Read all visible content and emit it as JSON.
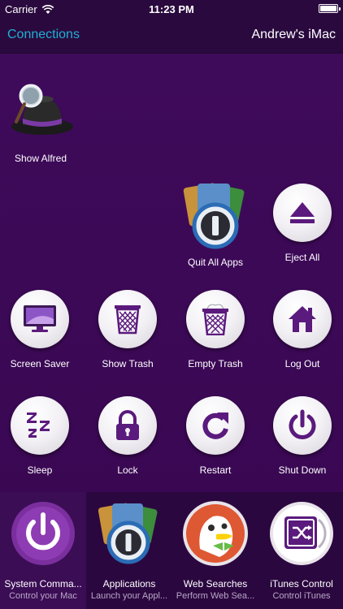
{
  "status_bar": {
    "carrier": "Carrier",
    "time": "11:23 PM"
  },
  "nav": {
    "back_label": "Connections",
    "title": "Andrew's iMac"
  },
  "tiles": {
    "show_alfred": "Show Alfred",
    "quit_all_apps": "Quit All Apps",
    "eject_all": "Eject All",
    "screen_saver": "Screen Saver",
    "show_trash": "Show Trash",
    "empty_trash": "Empty Trash",
    "log_out": "Log Out",
    "sleep": "Sleep",
    "lock": "Lock",
    "restart": "Restart",
    "shut_down": "Shut Down"
  },
  "dock": [
    {
      "title": "System Comma...",
      "subtitle": "Control your Mac"
    },
    {
      "title": "Applications",
      "subtitle": "Launch your Appl..."
    },
    {
      "title": "Web Searches",
      "subtitle": "Perform Web Sea..."
    },
    {
      "title": "iTunes Control",
      "subtitle": "Control iTunes"
    }
  ],
  "colors": {
    "background": "#3a0a52",
    "bar": "#2a0a3e",
    "accent": "#1fb0d4",
    "icon_purple": "#5b1a7d"
  }
}
